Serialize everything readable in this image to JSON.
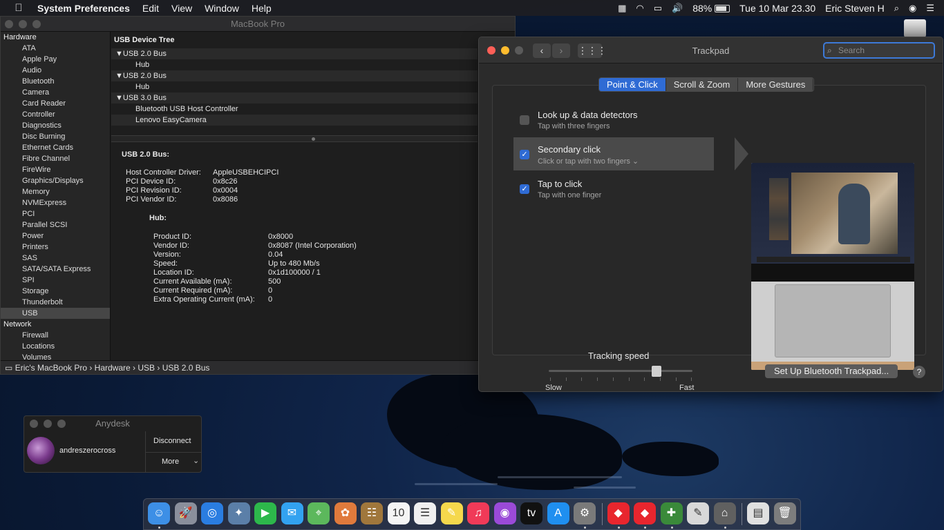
{
  "menubar": {
    "apple": "",
    "app_name": "System Preferences",
    "menus": [
      "Edit",
      "View",
      "Window",
      "Help"
    ],
    "battery": "88%",
    "datetime": "Tue 10 Mar  23.30",
    "user": "Eric Steven H",
    "icons": [
      "activity-monitor-icon",
      "wifi-icon",
      "airplay-icon",
      "volume-icon",
      "battery-icon",
      "search-icon",
      "siri-icon",
      "control-center-icon"
    ]
  },
  "sysinfo": {
    "title": "MacBook Pro",
    "sidebar": [
      {
        "type": "cat",
        "label": "Hardware"
      },
      {
        "type": "item",
        "label": "ATA"
      },
      {
        "type": "item",
        "label": "Apple Pay"
      },
      {
        "type": "item",
        "label": "Audio"
      },
      {
        "type": "item",
        "label": "Bluetooth"
      },
      {
        "type": "item",
        "label": "Camera"
      },
      {
        "type": "item",
        "label": "Card Reader"
      },
      {
        "type": "item",
        "label": "Controller"
      },
      {
        "type": "item",
        "label": "Diagnostics"
      },
      {
        "type": "item",
        "label": "Disc Burning"
      },
      {
        "type": "item",
        "label": "Ethernet Cards"
      },
      {
        "type": "item",
        "label": "Fibre Channel"
      },
      {
        "type": "item",
        "label": "FireWire"
      },
      {
        "type": "item",
        "label": "Graphics/Displays"
      },
      {
        "type": "item",
        "label": "Memory"
      },
      {
        "type": "item",
        "label": "NVMExpress"
      },
      {
        "type": "item",
        "label": "PCI"
      },
      {
        "type": "item",
        "label": "Parallel SCSI"
      },
      {
        "type": "item",
        "label": "Power"
      },
      {
        "type": "item",
        "label": "Printers"
      },
      {
        "type": "item",
        "label": "SAS"
      },
      {
        "type": "item",
        "label": "SATA/SATA Express"
      },
      {
        "type": "item",
        "label": "SPI"
      },
      {
        "type": "item",
        "label": "Storage"
      },
      {
        "type": "item",
        "label": "Thunderbolt"
      },
      {
        "type": "item",
        "label": "USB",
        "selected": true
      },
      {
        "type": "cat",
        "label": "Network"
      },
      {
        "type": "item",
        "label": "Firewall"
      },
      {
        "type": "item",
        "label": "Locations"
      },
      {
        "type": "item",
        "label": "Volumes"
      }
    ],
    "tree_header": "USB Device Tree",
    "tree": [
      {
        "level": 0,
        "label": "▼USB 2.0 Bus"
      },
      {
        "level": 1,
        "label": "Hub"
      },
      {
        "level": 0,
        "label": "▼USB 2.0 Bus"
      },
      {
        "level": 1,
        "label": "Hub"
      },
      {
        "level": 0,
        "label": "▼USB 3.0 Bus"
      },
      {
        "level": 1,
        "label": "Bluetooth USB Host Controller"
      },
      {
        "level": 1,
        "label": "Lenovo EasyCamera"
      }
    ],
    "detail_heading": "USB 2.0 Bus:",
    "bus_props": [
      {
        "k": "Host Controller Driver:",
        "v": "AppleUSBEHCIPCI"
      },
      {
        "k": "PCI Device ID:",
        "v": "0x8c26"
      },
      {
        "k": "PCI Revision ID:",
        "v": "0x0004"
      },
      {
        "k": "PCI Vendor ID:",
        "v": "0x8086"
      }
    ],
    "hub_heading": "Hub:",
    "hub_props": [
      {
        "k": "Product ID:",
        "v": "0x8000"
      },
      {
        "k": "Vendor ID:",
        "v": "0x8087  (Intel Corporation)"
      },
      {
        "k": "Version:",
        "v": "0.04"
      },
      {
        "k": "Speed:",
        "v": "Up to 480 Mb/s"
      },
      {
        "k": "Location ID:",
        "v": "0x1d100000 / 1"
      },
      {
        "k": "Current Available (mA):",
        "v": "500"
      },
      {
        "k": "Current Required (mA):",
        "v": "0"
      },
      {
        "k": "Extra Operating Current (mA):",
        "v": "0"
      }
    ],
    "breadcrumb": "Eric's MacBook Pro › Hardware › USB › USB 2.0 Bus"
  },
  "trackpad": {
    "title": "Trackpad",
    "search_placeholder": "Search",
    "tabs": [
      "Point & Click",
      "Scroll & Zoom",
      "More Gestures"
    ],
    "active_tab": 0,
    "options": [
      {
        "title": "Look up & data detectors",
        "sub": "Tap with three fingers",
        "checked": false,
        "selected": false
      },
      {
        "title": "Secondary click",
        "sub": "Click or tap with two fingers ⌄",
        "checked": true,
        "selected": true
      },
      {
        "title": "Tap to click",
        "sub": "Tap with one finger",
        "checked": true,
        "selected": false
      }
    ],
    "tracking_label": "Tracking speed",
    "slow": "Slow",
    "fast": "Fast",
    "tracking_value": 0.75,
    "bt_button": "Set Up Bluetooth Trackpad...",
    "help": "?"
  },
  "anydesk": {
    "title": "Anydesk",
    "user": "andreszerocross",
    "disconnect": "Disconnect",
    "more": "More"
  },
  "dock": {
    "apps": [
      {
        "name": "finder-icon",
        "color": "#3d8fe6",
        "glyph": "☺",
        "running": true
      },
      {
        "name": "launchpad-icon",
        "color": "#8a8f9c",
        "glyph": "🚀",
        "running": false
      },
      {
        "name": "safari-icon",
        "color": "#2a7de1",
        "glyph": "◎",
        "running": false
      },
      {
        "name": "preview-icon",
        "color": "#5b7fa8",
        "glyph": "✦",
        "running": false
      },
      {
        "name": "facetime-icon",
        "color": "#2db84b",
        "glyph": "▶",
        "running": false
      },
      {
        "name": "messages-icon",
        "color": "#32a2f0",
        "glyph": "✉",
        "running": false
      },
      {
        "name": "maps-icon",
        "color": "#5cb85c",
        "glyph": "⌖",
        "running": false
      },
      {
        "name": "photos-icon",
        "color": "#e07a3c",
        "glyph": "✿",
        "running": false
      },
      {
        "name": "contacts-icon",
        "color": "#a0773c",
        "glyph": "☷",
        "running": false
      },
      {
        "name": "calendar-icon",
        "color": "#f5f5f5",
        "glyph": "10",
        "running": false
      },
      {
        "name": "reminders-icon",
        "color": "#f0f0f0",
        "glyph": "☰",
        "running": false
      },
      {
        "name": "notes-icon",
        "color": "#f5d84c",
        "glyph": "✎",
        "running": false
      },
      {
        "name": "music-icon",
        "color": "#f03a58",
        "glyph": "♫",
        "running": false
      },
      {
        "name": "podcasts-icon",
        "color": "#9a4ad8",
        "glyph": "◉",
        "running": false
      },
      {
        "name": "apple-tv-icon",
        "color": "#111111",
        "glyph": "tv",
        "running": false
      },
      {
        "name": "app-store-icon",
        "color": "#1f8ff0",
        "glyph": "A",
        "running": false
      },
      {
        "name": "system-preferences-icon",
        "color": "#7a7a7a",
        "glyph": "⚙",
        "running": true
      },
      {
        "name": "anydesk-icon",
        "color": "#e8262e",
        "glyph": "◆",
        "running": true
      },
      {
        "name": "anydesk-2-icon",
        "color": "#e8262e",
        "glyph": "◆",
        "running": true
      },
      {
        "name": "system-information-icon",
        "color": "#3a8a3a",
        "glyph": "✚",
        "running": true
      },
      {
        "name": "script-editor-icon",
        "color": "#d8d8d8",
        "glyph": "✎",
        "running": false
      },
      {
        "name": "hanger-icon",
        "color": "#606060",
        "glyph": "⌂",
        "running": true
      },
      {
        "name": "document-icon",
        "color": "#e0e0e0",
        "glyph": "▤",
        "running": false
      },
      {
        "name": "trash-icon",
        "color": "#7d7d7d",
        "glyph": "🗑",
        "running": false
      }
    ]
  }
}
